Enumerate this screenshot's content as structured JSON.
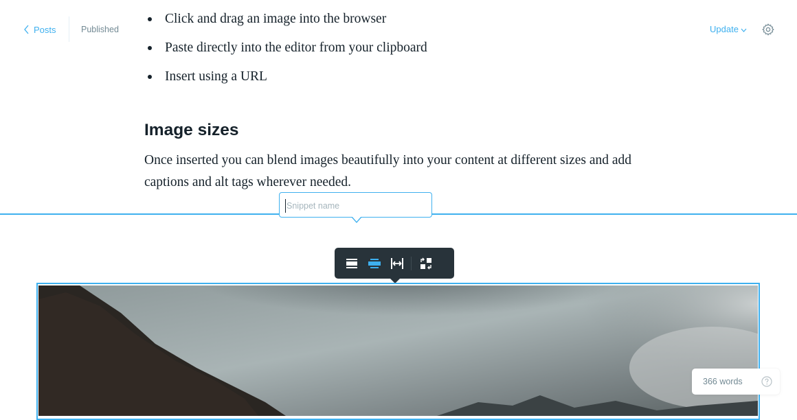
{
  "header": {
    "back_label": "Posts",
    "status": "Published",
    "update_label": "Update"
  },
  "content": {
    "bullets": [
      "Click and drag an image into the browser",
      "Paste directly into the editor from your clipboard",
      "Insert using a URL"
    ],
    "heading": "Image sizes",
    "paragraph": "Once inserted you can blend images beautifully into your content at different sizes and add captions and alt tags wherever needed."
  },
  "snippet": {
    "placeholder": "Snippet name",
    "value": ""
  },
  "image_toolbar": {
    "buttons": [
      {
        "icon": "image-width-regular-icon",
        "active": false
      },
      {
        "icon": "image-width-wide-icon",
        "active": true
      },
      {
        "icon": "image-width-full-icon",
        "active": false
      },
      {
        "icon": "image-replace-icon",
        "active": false
      }
    ]
  },
  "word_count": {
    "label": "366 words"
  },
  "colors": {
    "accent": "#3eb0ef",
    "text": "#15212a",
    "muted": "#738a94",
    "toolbar_bg": "#28333a"
  }
}
